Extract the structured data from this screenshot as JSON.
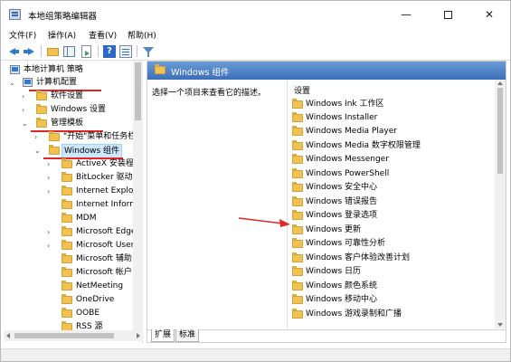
{
  "window": {
    "title": "本地组策略编辑器",
    "minimize_glyph": "—",
    "close_glyph": "✕"
  },
  "menu": [
    "文件(F)",
    "操作(A)",
    "查看(V)",
    "帮助(H)"
  ],
  "toolbar": {
    "icons": [
      "back-arrow-icon",
      "forward-arrow-icon",
      "up-folder-icon",
      "show-hide-tree-icon",
      "export-list-icon",
      "help-icon",
      "properties-icon",
      "filter-icon"
    ]
  },
  "tree": {
    "root": "本地计算机 策略",
    "computer_config": "计算机配置",
    "software_settings": "软件设置",
    "windows_settings": "Windows 设置",
    "admin_templates": "管理模板",
    "start_menu": "\"开始\"菜单和任务栏",
    "windows_components": "Windows 组件",
    "children": [
      "ActiveX 安装程序",
      "BitLocker 驱动器",
      "Internet Explorer",
      "Internet Inform",
      "MDM",
      "Microsoft Edge",
      "Microsoft User",
      "Microsoft 辅助",
      "Microsoft 帐户",
      "NetMeeting",
      "OneDrive",
      "OOBE",
      "RSS 源"
    ]
  },
  "right": {
    "header": "Windows 组件",
    "description": "选择一个项目来查看它的描述。",
    "column": "设置",
    "items": [
      "Windows Ink 工作区",
      "Windows Installer",
      "Windows Media Player",
      "Windows Media 数字权限管理",
      "Windows Messenger",
      "Windows PowerShell",
      "Windows 安全中心",
      "Windows 错误报告",
      "Windows 登录选项",
      "Windows 更新",
      "Windows 可靠性分析",
      "Windows 客户体验改善计划",
      "Windows 日历",
      "Windows 颜色系统",
      "Windows 移动中心",
      "Windows 游戏录制和广播"
    ],
    "tabs": [
      "扩展",
      "标准"
    ]
  },
  "colors": {
    "header_gradient_top": "#6a9bd6",
    "header_gradient_bottom": "#3b6fb8",
    "annotation_red": "#e32626",
    "selection": "#cce8ff"
  }
}
